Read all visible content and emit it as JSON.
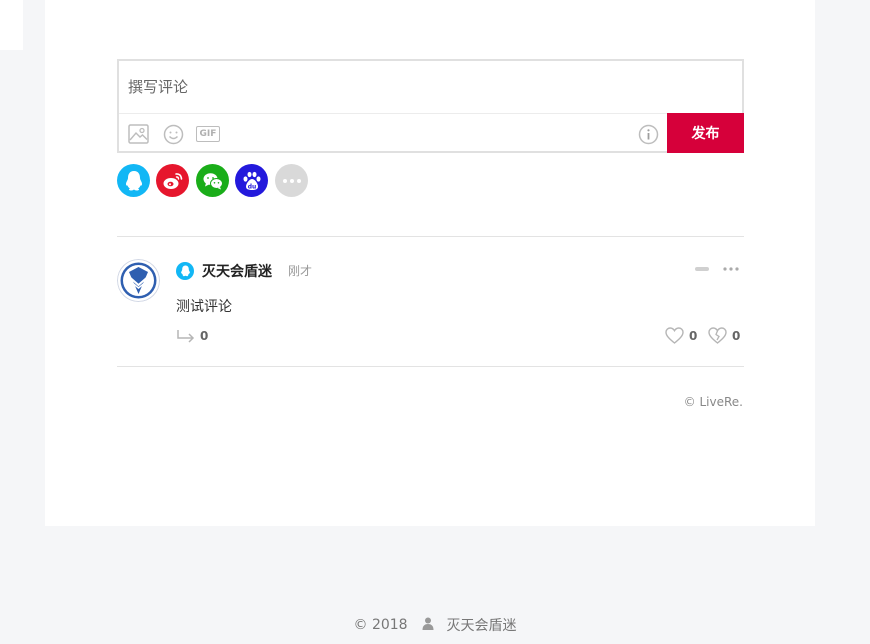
{
  "editor": {
    "placeholder": "撰写评论",
    "submit_label": "发布",
    "tools": [
      "image-icon",
      "emoji-icon",
      "gif-icon",
      "info-icon"
    ],
    "gif_label": "GIF"
  },
  "social_logins": [
    {
      "name": "qq-icon",
      "color": "#12b7f5"
    },
    {
      "name": "weibo-icon",
      "color": "#e6162d"
    },
    {
      "name": "wechat-icon",
      "color": "#1aad19"
    },
    {
      "name": "baidu-icon",
      "color": "#2319dc"
    },
    {
      "name": "more-icon",
      "color": "#d9d9d9"
    }
  ],
  "comment": {
    "platform_icon": "qq-icon",
    "author": "灭天会盾迷",
    "time": "刚才",
    "text": "测试评论",
    "reply_count": "0",
    "like_count": "0",
    "dislike_count": "0"
  },
  "credit": "© LiveRe.",
  "footer": {
    "copyright": "© 2018",
    "author_icon": "user-icon",
    "author": "灭天会盾迷"
  },
  "colors": {
    "accent": "#d6003a",
    "background": "#f5f6f8"
  }
}
